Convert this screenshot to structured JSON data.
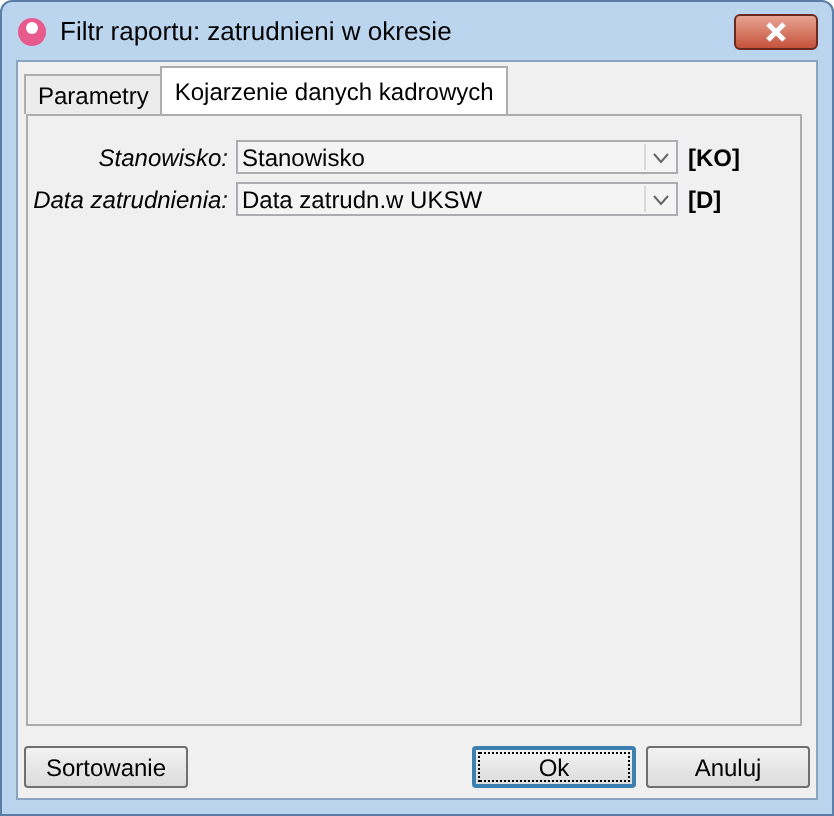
{
  "window": {
    "title": "Filtr raportu: zatrudnieni w okresie"
  },
  "tabs": [
    {
      "label": "Parametry",
      "selected": false
    },
    {
      "label": "Kojarzenie danych kadrowych",
      "selected": true
    }
  ],
  "fields": [
    {
      "label": "Stanowisko:",
      "value": "Stanowisko",
      "code": "[KO]"
    },
    {
      "label": "Data zatrudnienia:",
      "value": "Data zatrudn.w UKSW",
      "code": "[D]"
    }
  ],
  "buttons": [
    {
      "label": "Sortowanie",
      "default": false
    },
    {
      "label": "Ok",
      "default": true
    },
    {
      "label": "Anuluj",
      "default": false
    }
  ]
}
